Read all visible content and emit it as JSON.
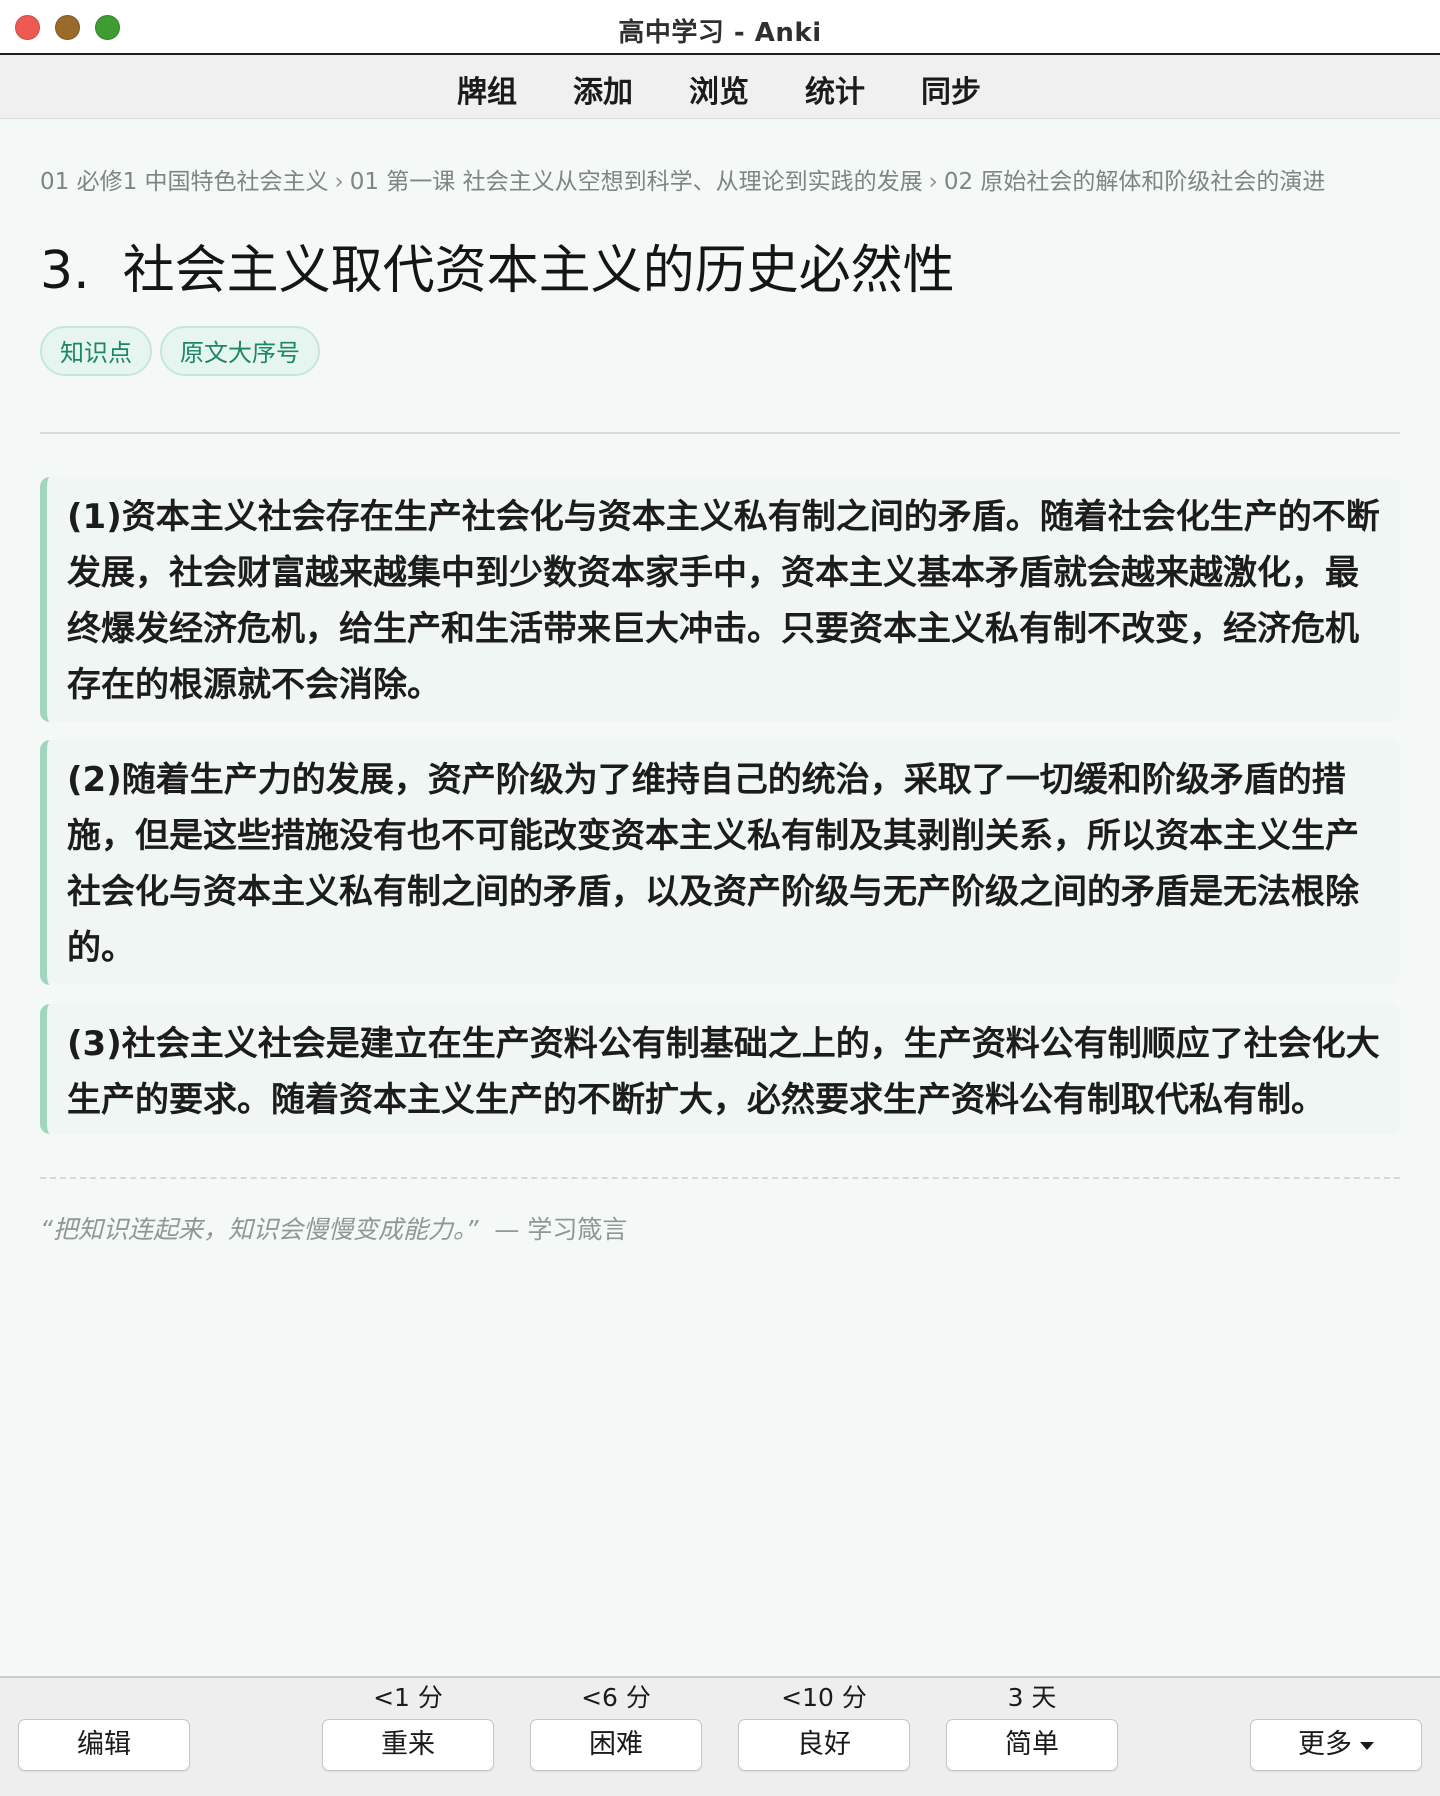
{
  "window": {
    "title": "高中学习 - Anki"
  },
  "menu": {
    "items": [
      "牌组",
      "添加",
      "浏览",
      "统计",
      "同步"
    ]
  },
  "breadcrumb": {
    "items": [
      "01 必修1 中国特色社会主义",
      "01 第一课 社会主义从空想到科学、从理论到实践的发展",
      "02 原始社会的解体和阶级社会的演进"
    ],
    "separator": "›"
  },
  "card": {
    "title": "3.  社会主义取代资本主义的历史必然性",
    "tags": [
      "知识点",
      "原文大序号"
    ],
    "paragraphs": [
      "(1)资本主义社会存在生产社会化与资本主义私有制之间的矛盾。随着社会化生产的不断发展，社会财富越来越集中到少数资本家手中，资本主义基本矛盾就会越来越激化，最终爆发经济危机，给生产和生活带来巨大冲击。只要资本主义私有制不改变，经济危机存在的根源就不会消除。",
      "(2)随着生产力的发展，资产阶级为了维持自己的统治，采取了一切缓和阶级矛盾的措施，但是这些措施没有也不可能改变资本主义私有制及其剥削关系，所以资本主义生产社会化与资本主义私有制之间的矛盾，以及资产阶级与无产阶级之间的矛盾是无法根除的。",
      "(3)社会主义社会是建立在生产资料公有制基础之上的，生产资料公有制顺应了社会化大生产的要求。随着资本主义生产的不断扩大，必然要求生产资料公有制取代私有制。"
    ],
    "quote_text": "“把知识连起来，知识会慢慢变成能力。”",
    "quote_author": "— 学习箴言"
  },
  "bottom": {
    "edit_label": "编辑",
    "answers": [
      {
        "interval": "<1 分",
        "label": "重来"
      },
      {
        "interval": "<6 分",
        "label": "困难"
      },
      {
        "interval": "<10 分",
        "label": "良好"
      },
      {
        "interval": "3 天",
        "label": "简单"
      }
    ],
    "more_label": "更多"
  },
  "colors": {
    "accent_green": "#1b8860",
    "card_border": "#9fd6bd",
    "tag_background": "#e6f5ef",
    "close_button": "#ee5a52",
    "minimize_button": "#9a6a2c",
    "zoom_button": "#3f9b34"
  }
}
